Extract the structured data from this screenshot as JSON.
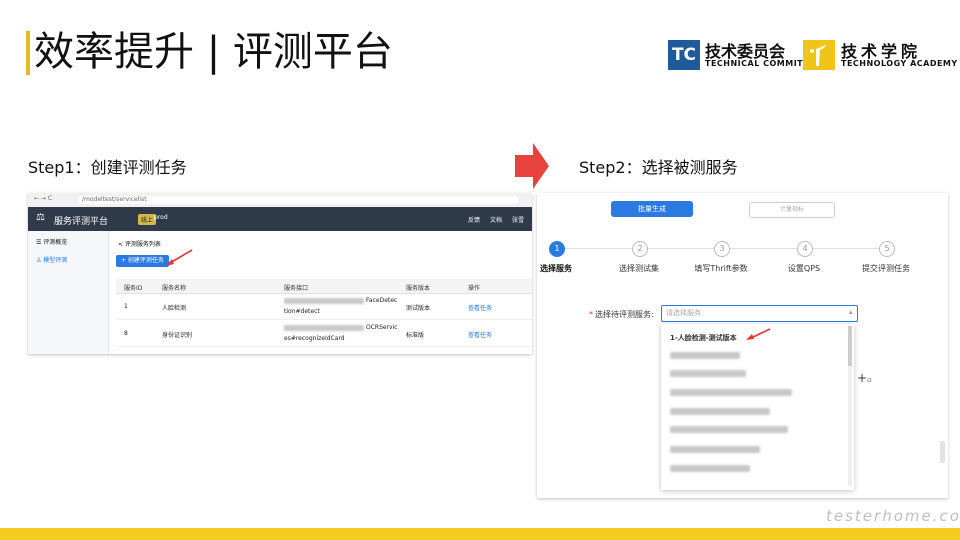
{
  "title": "效率提升 | 评测平台",
  "logos": {
    "technical_committee": {
      "badge": "TC",
      "cn": "技术委员会",
      "en": "TECHNICAL COMMITTEE"
    },
    "technology_academy": {
      "cn": "技术学院",
      "en": "TECHNOLOGY ACADEMY"
    }
  },
  "steps": {
    "step1": "Step1：创建评测任务",
    "step2": "Step2：选择被测服务"
  },
  "shot1": {
    "url": "/modeltest/servicelist",
    "brand": "服务评测平台",
    "env_badge": "线上",
    "env_name": "prod",
    "nav_links": [
      "反馈",
      "文档",
      "张雪"
    ],
    "sidebar": [
      "☰ 评测概览",
      "♙ 模型评测"
    ],
    "breadcrumb": "< 评测服务列表",
    "create_button": "+ 创建评测任务",
    "columns": [
      "服务ID",
      "服务名称",
      "服务接口",
      "服务版本",
      "操作"
    ],
    "rows": [
      {
        "id": "1",
        "name": "人脸检测",
        "iface_a": "FaceDetec",
        "iface_b": "tion#detect",
        "version": "测试版本",
        "action": "查看任务"
      },
      {
        "id": "8",
        "name": "身份证识别",
        "iface_a": "OCRServic",
        "iface_b": "es#recognizeIdCard",
        "version": "标准版",
        "action": "查看任务"
      }
    ]
  },
  "shot2": {
    "tabs": {
      "active": "批量生成",
      "inactive": "计量指标"
    },
    "wizard": [
      {
        "num": "1",
        "label": "选择服务"
      },
      {
        "num": "2",
        "label": "选择测试集"
      },
      {
        "num": "3",
        "label": "填写Thrift参数"
      },
      {
        "num": "4",
        "label": "设置QPS"
      },
      {
        "num": "5",
        "label": "提交评测任务"
      }
    ],
    "field_required": "*",
    "field_label": "选择待评测服务:",
    "select_placeholder": "请选择服务",
    "first_option": "1-人脸检测-测试版本"
  },
  "watermark": "testerhome.com",
  "colors": {
    "accent_yellow": "#f5cd1e",
    "primary_blue": "#2a7ae2",
    "arrow_red": "#e8423c",
    "nav_dark": "#2f3a4a",
    "tc_blue": "#1f5a9a"
  }
}
